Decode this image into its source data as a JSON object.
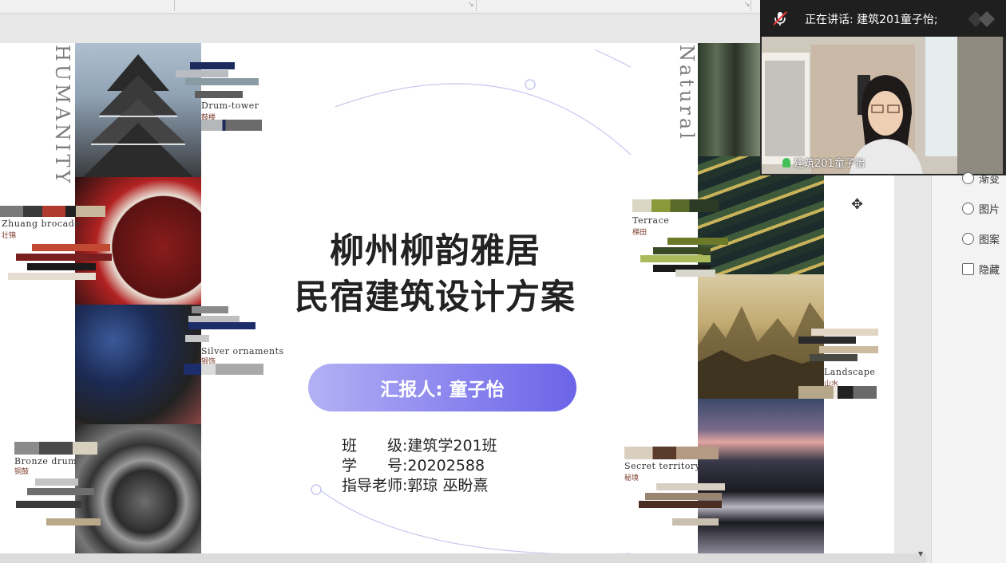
{
  "presentation": {
    "title_line1": "柳州柳韵雅居",
    "title_line2": "民宿建筑设计方案",
    "reporter": "汇报人: 童子怡",
    "class_label": "班　　级:",
    "class_value": "建筑学201班",
    "student_id_label": "学　　号:",
    "student_id_value": "20202588",
    "advisor_label": "指导老师:",
    "advisor_value": "郭琼  巫盼熹",
    "left_vertical": "HUMANITY",
    "right_vertical": "Natural",
    "left_items": [
      {
        "en": "Drum-tower",
        "zh": "鼓楼"
      },
      {
        "en": "Zhuang brocade",
        "zh": "壮锦"
      },
      {
        "en": "Silver ornaments",
        "zh": "银饰"
      },
      {
        "en": "Bronze drum",
        "zh": "铜鼓"
      }
    ],
    "right_items": [
      {
        "en": "Terrace",
        "zh": "梯田"
      },
      {
        "en": "Landscape",
        "zh": "山水"
      },
      {
        "en": "Secret territory",
        "zh": "秘境"
      }
    ]
  },
  "meeting": {
    "speaking_label": "正在讲话:",
    "speaker_name": "建筑201童子怡;",
    "video_participant": "建筑201童子怡"
  },
  "options_panel": {
    "items": [
      {
        "type": "radio",
        "label": "渐变"
      },
      {
        "type": "radio",
        "label": "图片"
      },
      {
        "type": "radio",
        "label": "图案"
      },
      {
        "type": "checkbox",
        "label": "隐藏"
      }
    ]
  },
  "colors": {
    "accent_gradient_start": "#b3b1f4",
    "accent_gradient_end": "#6b64e8"
  }
}
